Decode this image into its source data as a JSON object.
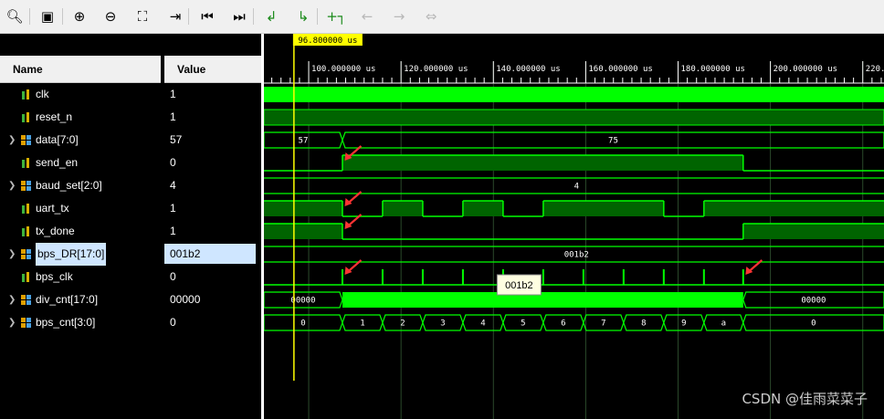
{
  "toolbar": {
    "icons": [
      "search-icon",
      "save-icon",
      "zoom-in-icon",
      "zoom-out-icon",
      "zoom-fit-icon",
      "go-to-cursor-icon",
      "go-to-time-0-icon",
      "go-to-last-time-icon",
      "previous-transition-icon",
      "next-transition-icon",
      "add-marker-icon",
      "previous-marker-icon",
      "next-marker-icon",
      "swap-cursors-icon"
    ]
  },
  "columns": {
    "name": "Name",
    "value": "Value"
  },
  "signals": [
    {
      "name": "clk",
      "value": "1",
      "kind": "scalar"
    },
    {
      "name": "reset_n",
      "value": "1",
      "kind": "scalar"
    },
    {
      "name": "data[7:0]",
      "value": "57",
      "kind": "bus"
    },
    {
      "name": "send_en",
      "value": "0",
      "kind": "scalar"
    },
    {
      "name": "baud_set[2:0]",
      "value": "4",
      "kind": "bus"
    },
    {
      "name": "uart_tx",
      "value": "1",
      "kind": "scalar"
    },
    {
      "name": "tx_done",
      "value": "1",
      "kind": "scalar"
    },
    {
      "name": "bps_DR[17:0]",
      "value": "001b2",
      "kind": "bus",
      "selected": true
    },
    {
      "name": "bps_clk",
      "value": "0",
      "kind": "scalar"
    },
    {
      "name": "div_cnt[17:0]",
      "value": "00000",
      "kind": "bus"
    },
    {
      "name": "bps_cnt[3:0]",
      "value": "0",
      "kind": "bus"
    }
  ],
  "cursor": {
    "label": "96.800000 us",
    "time_us": 96.8
  },
  "timeline": {
    "start_us": 90.3,
    "end_us": 224.6,
    "ticks": [
      {
        "t": 100,
        "label": "100.000000 us"
      },
      {
        "t": 120,
        "label": "120.000000 us"
      },
      {
        "t": 140,
        "label": "140.000000 us"
      },
      {
        "t": 160,
        "label": "160.000000 us"
      },
      {
        "t": 180,
        "label": "180.000000 us"
      },
      {
        "t": 200,
        "label": "200.000000 us"
      },
      {
        "t": 220,
        "label": "220.0"
      }
    ]
  },
  "waves": {
    "data": {
      "segments": [
        {
          "t0": 90.3,
          "t1": 107.3,
          "label": "57"
        },
        {
          "t0": 107.3,
          "t1": 224.6,
          "label": "75"
        }
      ]
    },
    "send_en": {
      "transitions": [
        [
          90.3,
          0
        ],
        [
          107.3,
          1
        ],
        [
          194.1,
          0
        ]
      ]
    },
    "baud_set": {
      "label": "4"
    },
    "uart_tx": {
      "transitions": [
        [
          90.3,
          1
        ],
        [
          107.3,
          0
        ],
        [
          116.0,
          1
        ],
        [
          124.7,
          0
        ],
        [
          133.4,
          1
        ],
        [
          142.1,
          0
        ],
        [
          150.8,
          1
        ],
        [
          176.9,
          0
        ],
        [
          185.6,
          1
        ]
      ]
    },
    "tx_done": {
      "transitions": [
        [
          90.3,
          1
        ],
        [
          107.3,
          0
        ],
        [
          194.1,
          1
        ]
      ]
    },
    "bps_DR": {
      "label": "001b2"
    },
    "bps_clk": {
      "pulses": [
        107.3,
        116.0,
        124.7,
        133.4,
        142.1,
        150.8,
        159.5,
        168.2,
        176.9,
        185.6,
        194.1
      ]
    },
    "div_cnt": {
      "segments": [
        {
          "t0": 90.3,
          "t1": 107.3,
          "label": "00000"
        },
        {
          "t0": 194.1,
          "t1": 224.6,
          "label": "00000"
        }
      ],
      "busy": [
        107.3,
        194.1
      ]
    },
    "bps_cnt": {
      "segments": [
        {
          "t0": 90.3,
          "t1": 107.3,
          "label": "0"
        },
        {
          "t0": 107.3,
          "t1": 116.0,
          "label": "1"
        },
        {
          "t0": 116.0,
          "t1": 124.7,
          "label": "2"
        },
        {
          "t0": 124.7,
          "t1": 133.4,
          "label": "3"
        },
        {
          "t0": 133.4,
          "t1": 142.1,
          "label": "4"
        },
        {
          "t0": 142.1,
          "t1": 150.8,
          "label": "5"
        },
        {
          "t0": 150.8,
          "t1": 159.5,
          "label": "6"
        },
        {
          "t0": 159.5,
          "t1": 168.2,
          "label": "7"
        },
        {
          "t0": 168.2,
          "t1": 176.9,
          "label": "8"
        },
        {
          "t0": 176.9,
          "t1": 185.6,
          "label": "9"
        },
        {
          "t0": 185.6,
          "t1": 194.1,
          "label": "a"
        },
        {
          "t0": 194.1,
          "t1": 224.6,
          "label": "0"
        }
      ]
    },
    "tooltip": {
      "text": "001b2",
      "t": 142.0
    },
    "arrows": [
      {
        "row": "send_en",
        "t": 107.8
      },
      {
        "row": "uart_tx",
        "t": 107.8
      },
      {
        "row": "tx_done",
        "t": 107.8
      },
      {
        "row": "bps_clk",
        "t": 107.8
      },
      {
        "row": "bps_clk",
        "t": 194.6
      }
    ]
  },
  "watermark": "CSDN @佳雨菜菜子",
  "colors": {
    "wave": "#00ff00",
    "wave_fill": "#006400",
    "cursor": "#ffff00",
    "arrow": "#ff3333",
    "grid": "#2b4a2b"
  }
}
